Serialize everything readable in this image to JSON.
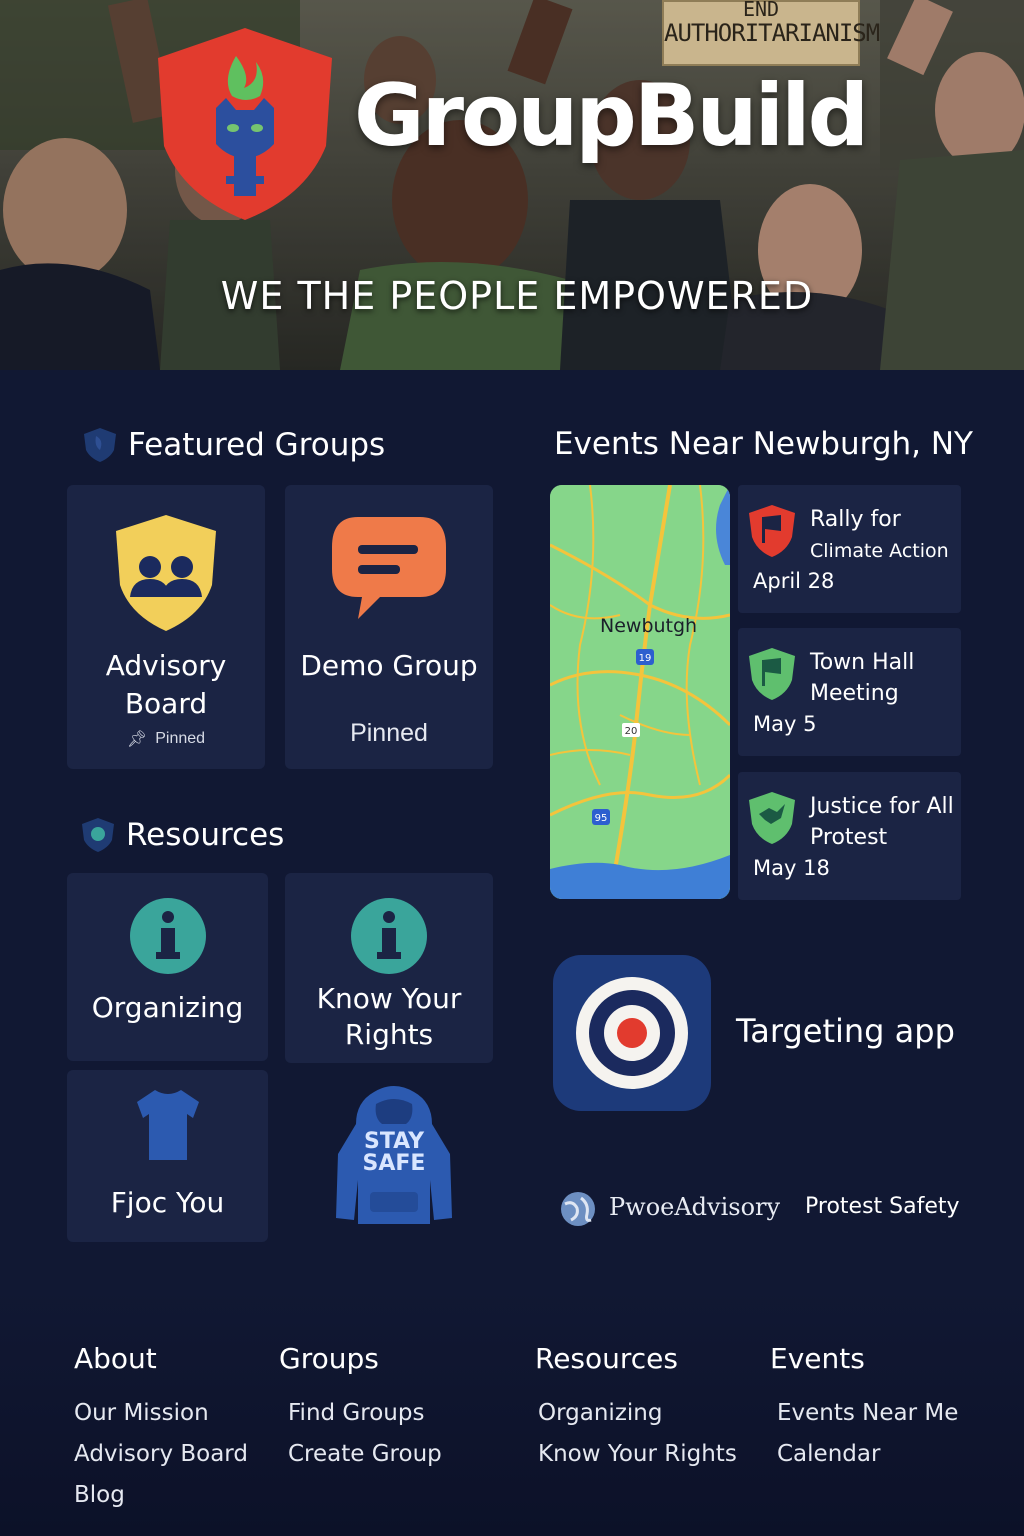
{
  "brand": {
    "name": "GroupBuild",
    "tagline": "WE THE PEOPLE EMPOWERED",
    "hero_sign_text": [
      "END",
      "AUTHORITARIANISM"
    ]
  },
  "colors": {
    "background": "#111833",
    "card": "#1b2444",
    "shield_red": "#e23b2e",
    "accent_teal": "#3aa59b",
    "accent_orange": "#ef7a49",
    "accent_yellow": "#f2cf5a"
  },
  "featured_groups": {
    "heading": "Featured Groups",
    "icon": "shield-icon",
    "items": [
      {
        "title": "Advisory Board",
        "badge": "Pinned",
        "icon": "group-shield-icon"
      },
      {
        "title": "Demo Group",
        "badge": "Pinned",
        "icon": "chat-bubble-icon"
      }
    ]
  },
  "resources": {
    "heading": "Resources",
    "icon": "shield-icon",
    "items": [
      {
        "title": "Organizing",
        "icon": "info-icon"
      },
      {
        "title": "Know Your Rights",
        "icon": "info-icon"
      },
      {
        "title": "Fјoc You",
        "icon": "tshirt-icon"
      },
      {
        "title": "",
        "icon": "hoodie-icon",
        "hoodie_text": [
          "STAY",
          "SAFE"
        ]
      }
    ]
  },
  "events": {
    "heading_prefix": "Events Near",
    "location": "Newburgh, NY",
    "map": {
      "city_label": "Newbutgh",
      "route_labels": [
        "19",
        "20",
        "95"
      ]
    },
    "items": [
      {
        "title": "Rally for",
        "subtitle": "Climate Action",
        "date": "April 28",
        "icon": "red-flag-shield-icon"
      },
      {
        "title": "Town Hall Meeting",
        "subtitle": "",
        "date": "May 5",
        "icon": "green-flag-shield-icon"
      },
      {
        "title": "Justice for All Protest",
        "subtitle": "",
        "date": "May 18",
        "icon": "green-bird-shield-icon"
      }
    ]
  },
  "app_promo": {
    "label": "Targeting app",
    "icon": "target-icon"
  },
  "partners": {
    "name": "PwoeAdvisory",
    "link": "Protest Safety",
    "icon": "globe-icon"
  },
  "footer": {
    "columns": [
      {
        "title": "About",
        "links": [
          "Our Mission",
          "Advisory Board",
          "Blog"
        ]
      },
      {
        "title": "Groups",
        "links": [
          "Find Groups",
          "Create Group"
        ]
      },
      {
        "title": "Resources",
        "links": [
          "Organizing",
          "Know Your Rights"
        ]
      },
      {
        "title": "Events",
        "links": [
          "Events Near Me",
          "Calendar"
        ]
      }
    ]
  }
}
